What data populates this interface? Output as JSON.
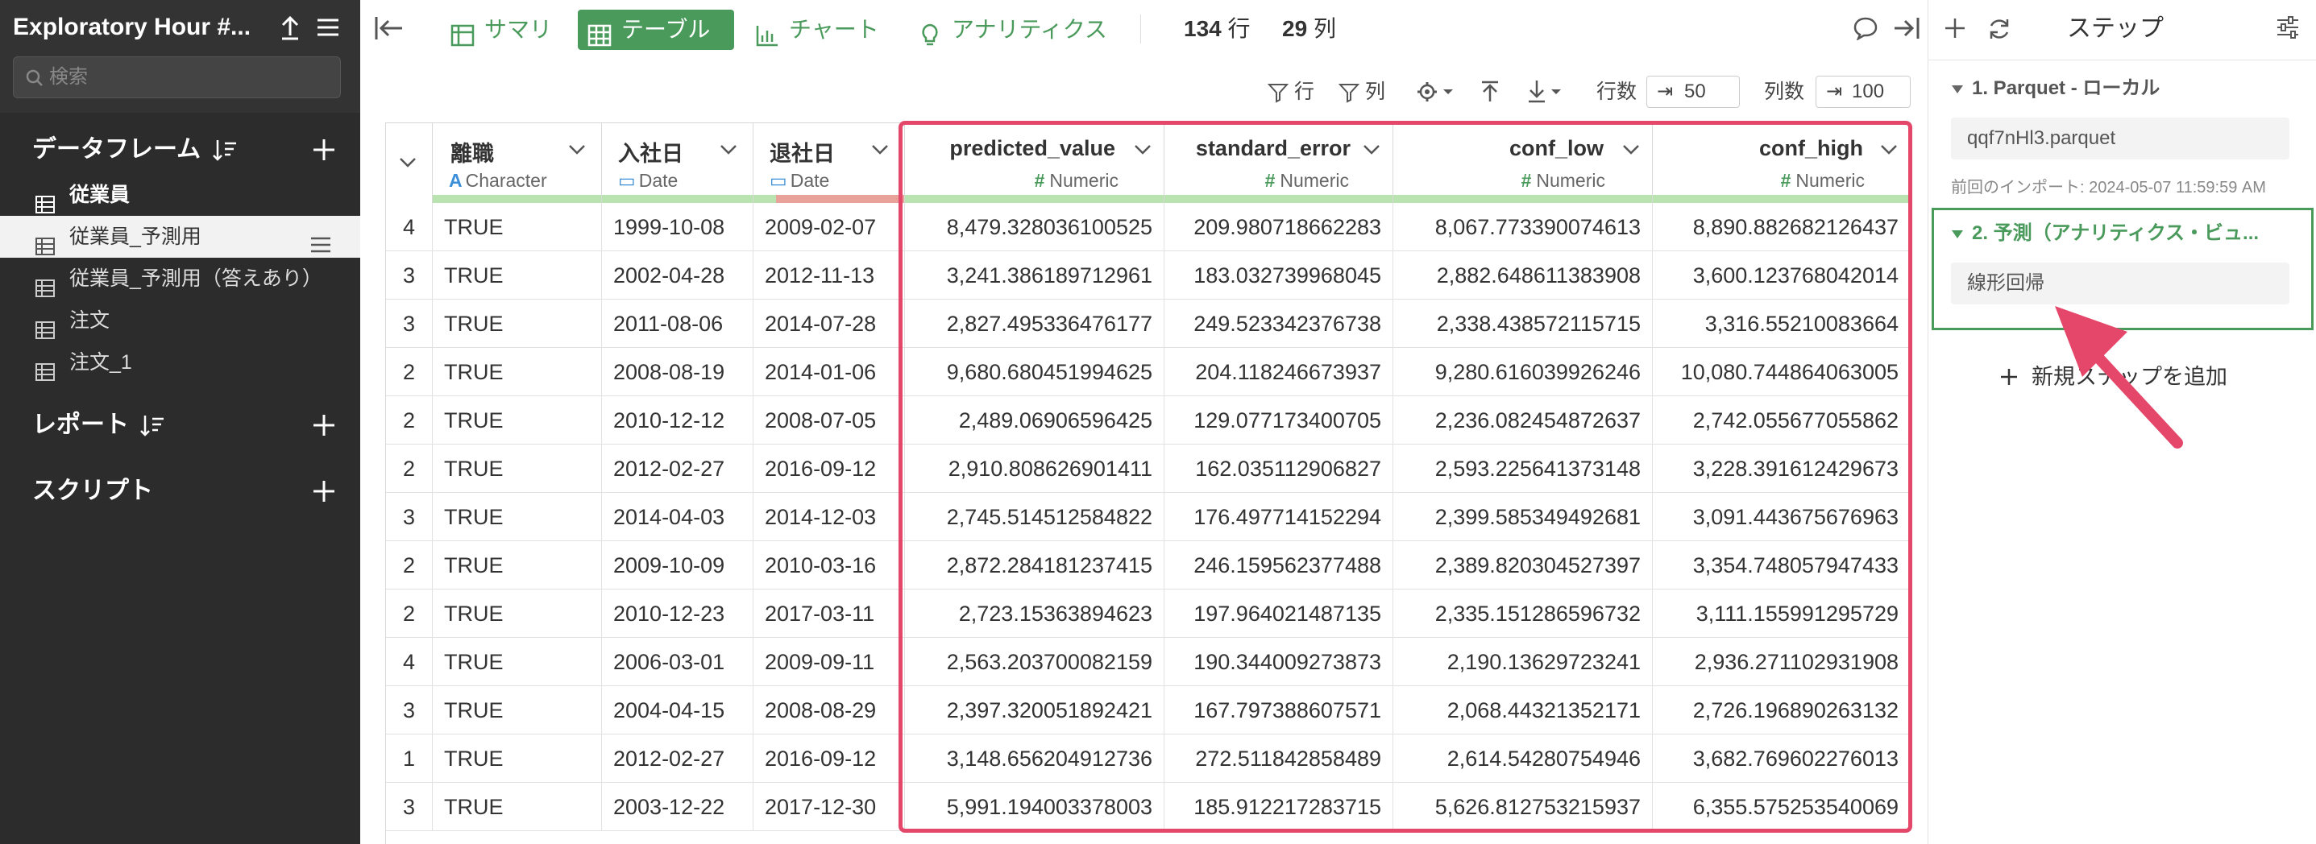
{
  "sidebar": {
    "title": "Exploratory Hour #...",
    "search_placeholder": "検索",
    "sections": {
      "dataframes": "データフレーム",
      "reports": "レポート",
      "scripts": "スクリプト"
    },
    "dataframes": [
      {
        "label": "従業員"
      },
      {
        "label": "従業員_予測用"
      },
      {
        "label": "従業員_予測用（答えあり）"
      },
      {
        "label": "注文"
      },
      {
        "label": "注文_1"
      }
    ]
  },
  "toolbar": {
    "tabs": [
      {
        "label": "サマリ"
      },
      {
        "label": "テーブル"
      },
      {
        "label": "チャート"
      },
      {
        "label": "アナリティクス"
      }
    ],
    "rows_count": "134",
    "rows_unit": "行",
    "cols_count": "29",
    "cols_unit": "列"
  },
  "controls": {
    "row_filter": "行",
    "col_filter": "列",
    "rows_label": "行数",
    "rows_value": "50",
    "cols_label": "列数",
    "cols_value": "100"
  },
  "table": {
    "columns": [
      {
        "name": "",
        "type": ""
      },
      {
        "name": "離職",
        "type": "Character"
      },
      {
        "name": "入社日",
        "type": "Date"
      },
      {
        "name": "退社日",
        "type": "Date"
      },
      {
        "name": "predicted_value",
        "type": "Numeric"
      },
      {
        "name": "standard_error",
        "type": "Numeric"
      },
      {
        "name": "conf_low",
        "type": "Numeric"
      },
      {
        "name": "conf_high",
        "type": "Numeric"
      }
    ],
    "rows": [
      [
        "4",
        "TRUE",
        "1999-10-08",
        "2009-02-07",
        "8,479.328036100525",
        "209.980718662283",
        "8,067.773390074613",
        "8,890.882682126437"
      ],
      [
        "3",
        "TRUE",
        "2002-04-28",
        "2012-11-13",
        "3,241.386189712961",
        "183.032739968045",
        "2,882.648611383908",
        "3,600.123768042014"
      ],
      [
        "3",
        "TRUE",
        "2011-08-06",
        "2014-07-28",
        "2,827.495336476177",
        "249.523342376738",
        "2,338.438572115715",
        "3,316.55210083664"
      ],
      [
        "2",
        "TRUE",
        "2008-08-19",
        "2014-01-06",
        "9,680.680451994625",
        "204.118246673937",
        "9,280.616039926246",
        "10,080.744864063005"
      ],
      [
        "2",
        "TRUE",
        "2010-12-12",
        "2008-07-05",
        "2,489.06906596425",
        "129.077173400705",
        "2,236.082454872637",
        "2,742.055677055862"
      ],
      [
        "2",
        "TRUE",
        "2012-02-27",
        "2016-09-12",
        "2,910.808626901411",
        "162.035112906827",
        "2,593.225641373148",
        "3,228.391612429673"
      ],
      [
        "3",
        "TRUE",
        "2014-04-03",
        "2014-12-03",
        "2,745.514512584822",
        "176.497714152294",
        "2,399.585349492681",
        "3,091.443675676963"
      ],
      [
        "2",
        "TRUE",
        "2009-10-09",
        "2010-03-16",
        "2,872.284181237415",
        "246.159562377488",
        "2,389.820304527397",
        "3,354.748057947433"
      ],
      [
        "2",
        "TRUE",
        "2010-12-23",
        "2017-03-11",
        "2,723.15363894623",
        "197.964021487135",
        "2,335.151286596732",
        "3,111.155991295729"
      ],
      [
        "4",
        "TRUE",
        "2006-03-01",
        "2009-09-11",
        "2,563.203700082159",
        "190.344009273873",
        "2,190.13629723241",
        "2,936.271102931908"
      ],
      [
        "3",
        "TRUE",
        "2004-04-15",
        "2008-08-29",
        "2,397.320051892421",
        "167.797388607571",
        "2,068.44321352171",
        "2,726.196890263132"
      ],
      [
        "1",
        "TRUE",
        "2012-02-27",
        "2016-09-12",
        "3,148.656204912736",
        "272.511842858489",
        "2,614.54280754946",
        "3,682.769602276013"
      ],
      [
        "3",
        "TRUE",
        "2003-12-22",
        "2017-12-30",
        "5,991.194003378003",
        "185.912217283715",
        "5,626.812753215937",
        "6,355.575253540069"
      ]
    ]
  },
  "steps": {
    "title": "ステップ",
    "step1_title": "1. Parquet - ローカル",
    "step1_file": "qqf7nHl3.parquet",
    "step1_meta": "前回のインポート: 2024-05-07 11:59:59 AM",
    "step2_title": "2. 予測（アナリティクス・ビュ...",
    "step2_model": "線形回帰",
    "add_step": "新規ステップを追加"
  },
  "colors": {
    "sidebar_bg": "#333333",
    "accent_green": "#4a9a5c",
    "highlight_red": "#e5476a",
    "date_blue": "#3a8fd8"
  },
  "icons": [
    "upload-icon",
    "menu-icon",
    "search-icon",
    "sort-icon",
    "plus-icon",
    "table-icon",
    "summary-icon",
    "chart-icon",
    "analytics-icon",
    "comment-icon",
    "exit-icon",
    "filter-icon",
    "gear-icon",
    "refresh-icon",
    "settings-icon",
    "arrow-annotation-icon"
  ]
}
